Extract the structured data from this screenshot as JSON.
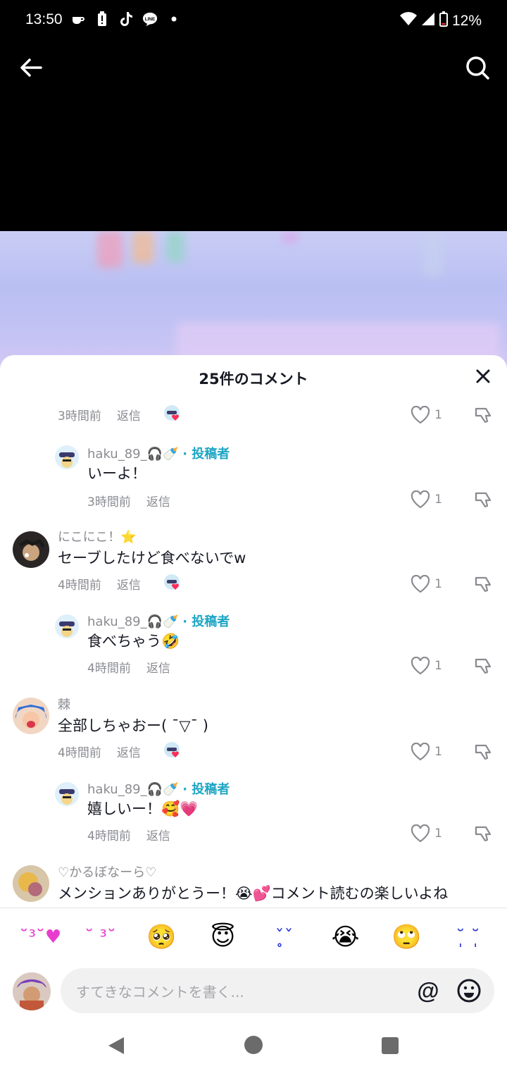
{
  "status": {
    "time": "13:50",
    "battery": "12%",
    "left_icons": [
      "coffee-icon",
      "battery-alert-icon",
      "tiktok-icon",
      "line-icon",
      "dot-icon"
    ]
  },
  "video_header": {
    "back_icon": "arrow-left-icon",
    "search_icon": "search-icon"
  },
  "comments_panel": {
    "title": "25件のコメント",
    "close_icon": "close-icon",
    "comments": [
      {
        "kind": "meta-only",
        "time": "3時間前",
        "reply_label": "返信",
        "likes": "1"
      },
      {
        "kind": "reply",
        "username": "haku_89_🎧🍼",
        "author_badge": "· 投稿者",
        "text": "いーよ！",
        "time": "3時間前",
        "reply_label": "返信",
        "likes": "1"
      },
      {
        "kind": "top",
        "username": "にこにこ！⭐",
        "text": "セーブしたけど食べないでw",
        "time": "4時間前",
        "reply_label": "返信",
        "likes": "1"
      },
      {
        "kind": "reply",
        "username": "haku_89_🎧🍼",
        "author_badge": "· 投稿者",
        "text": "食べちゃう🤣",
        "time": "4時間前",
        "reply_label": "返信",
        "likes": "1"
      },
      {
        "kind": "top",
        "username": "棘",
        "text": "全部しちゃおー( ˉ▽ˉ )",
        "time": "4時間前",
        "reply_label": "返信",
        "likes": "1"
      },
      {
        "kind": "reply",
        "username": "haku_89_🎧🍼",
        "author_badge": "· 投稿者",
        "text": "嬉しいー！🥰💗",
        "time": "4時間前",
        "reply_label": "返信",
        "likes": "1"
      },
      {
        "kind": "top",
        "username": "♡かるぼなーら♡",
        "text": "メンションありがとうー！😭💕コメント読むの楽しいよね"
      }
    ]
  },
  "emoji_bar": [
    "˘³˘♥",
    "˘ ³˘",
    "🥺",
    "😇",
    "ˇ̥ˇ",
    "😭",
    "🙄",
    "˘̩ ˘̩"
  ],
  "comment_input": {
    "placeholder": "すてきなコメントを書く...",
    "at_label": "@"
  }
}
